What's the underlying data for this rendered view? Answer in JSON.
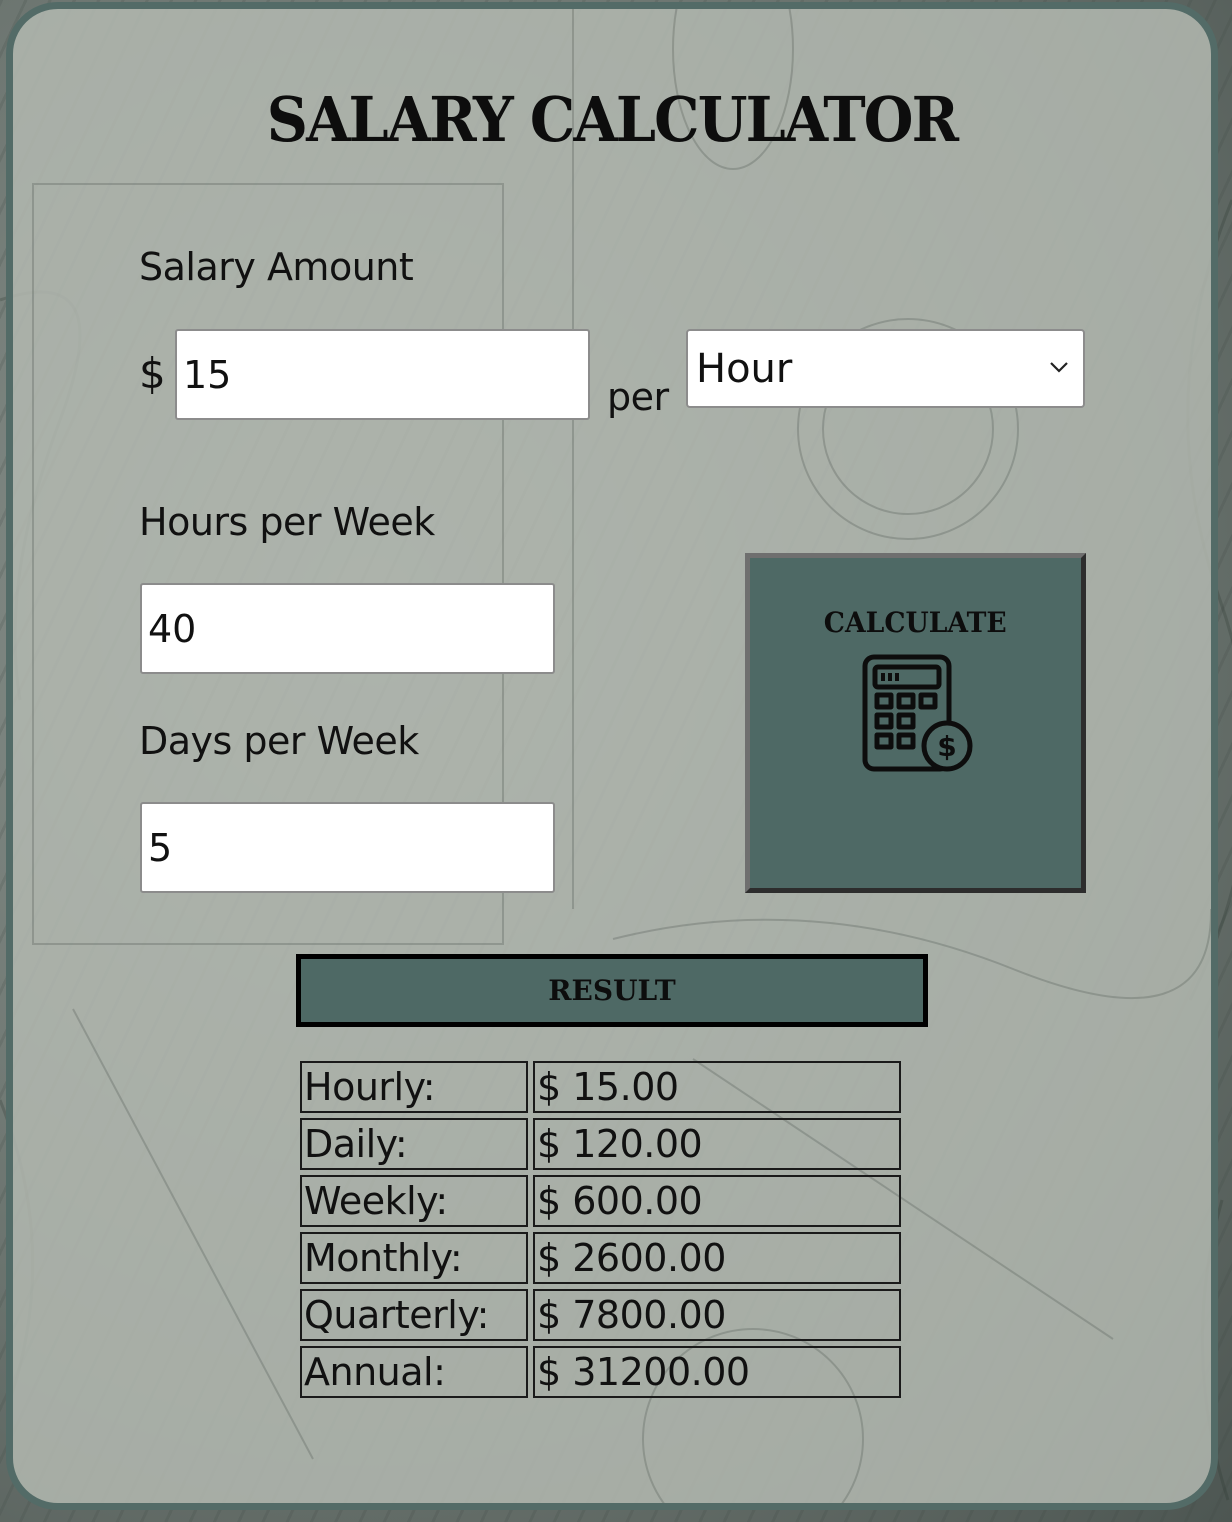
{
  "app": {
    "title": "SALARY CALCULATOR"
  },
  "salary": {
    "label": "Salary Amount",
    "currency_symbol": "$",
    "amount_value": "15",
    "per_label": "per",
    "period_selected": "Hour",
    "period_icon": "chevron-down-icon"
  },
  "hours": {
    "label": "Hours per Week",
    "value": "40"
  },
  "days": {
    "label": "Days per Week",
    "value": "5"
  },
  "calculate": {
    "label": "CALCULATE",
    "icon": "calculator-dollar-icon"
  },
  "result": {
    "header": "RESULT",
    "rows": [
      {
        "label": "Hourly:",
        "value": "$ 15.00"
      },
      {
        "label": "Daily:",
        "value": "$ 120.00"
      },
      {
        "label": "Weekly:",
        "value": "$ 600.00"
      },
      {
        "label": "Monthly:",
        "value": "$ 2600.00"
      },
      {
        "label": "Quarterly:",
        "value": "$ 7800.00"
      },
      {
        "label": "Annual:",
        "value": "$ 31200.00"
      }
    ]
  },
  "colors": {
    "accent": "#4e6965",
    "card_border": "#536b67",
    "card_background": "#b2b8b0",
    "text": "#111111"
  }
}
